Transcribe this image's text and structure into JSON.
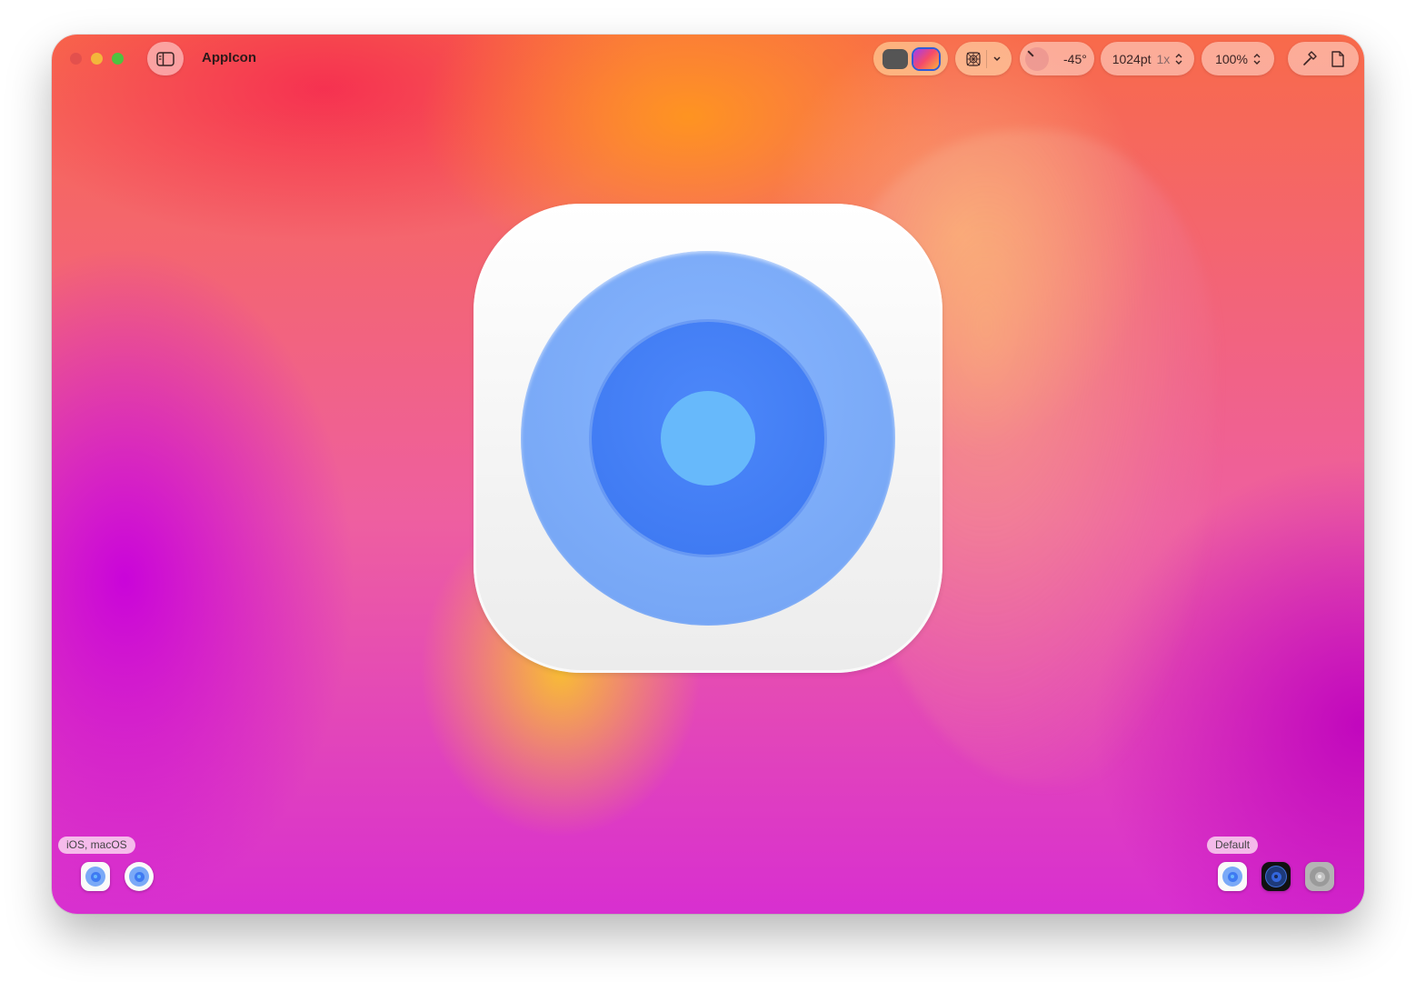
{
  "window": {
    "title": "AppIcon"
  },
  "toolbar": {
    "angle": "-45°",
    "size_value": "1024pt",
    "size_scale": "1x",
    "zoom": "100%",
    "chevron_up_down": "⌃⌄"
  },
  "groups": {
    "platforms_label": "iOS, macOS",
    "appearance_label": "Default"
  },
  "colors": {
    "icon_outer": "#78a8f6",
    "icon_middle": "#3f7af2",
    "icon_core": "#67b9fb"
  },
  "icons": [
    "sidebar-icon",
    "dark-mode-swatch",
    "color-mode-swatch",
    "grid-icon",
    "chevron-down-icon",
    "angle-dial-icon",
    "hammer-icon",
    "document-icon"
  ]
}
